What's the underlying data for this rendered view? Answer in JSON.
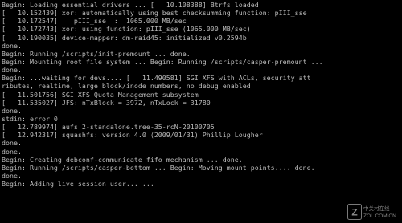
{
  "console": {
    "lines": [
      "Begin: Loading essential drivers ... [   10.108388] Btrfs loaded",
      "[   10.152439] xor: automatically using best checksumming function: pIII_sse",
      "[   10.172547]    pIII_sse  :  1065.000 MB/sec",
      "[   10.172743] xor: using function: pIII_sse (1065.000 MB/sec)",
      "[   10.190035] device-mapper: dm-raid45: initialized v0.2594b",
      "done.",
      "Begin: Running /scripts/init-premount ... done.",
      "Begin: Mounting root file system ... Begin: Running /scripts/casper-premount ...",
      "done.",
      "Begin: ...waiting for devs.... [   11.490581] SGI XFS with ACLs, security att",
      "ributes, realtime, large block/inode numbers, no debug enabled",
      "[   11.501756] SGI XFS Quota Management subsystem",
      "[   11.535027] JFS: nTxBlock = 3972, nTxLock = 31780",
      "done.",
      "stdin: error 0",
      "[   12.789974] aufs 2-standalone.tree-35-rcN-20100705",
      "[   12.942317] squashfs: version 4.0 (2009/01/31) Phillip Lougher",
      "done.",
      "done.",
      "Begin: Creating debconf-communicate fifo mechanism ... done.",
      "Begin: Running /scripts/casper-bottom ... Begin: Moving mount points.... done.",
      "done.",
      "Begin: Adding live session user... ..."
    ]
  },
  "watermark": {
    "logo_text": "ZOL",
    "caption": "中关村在线",
    "url": "ZOL.COM.CN"
  },
  "colors": {
    "background": "#000000",
    "text": "#bdbdbd"
  }
}
